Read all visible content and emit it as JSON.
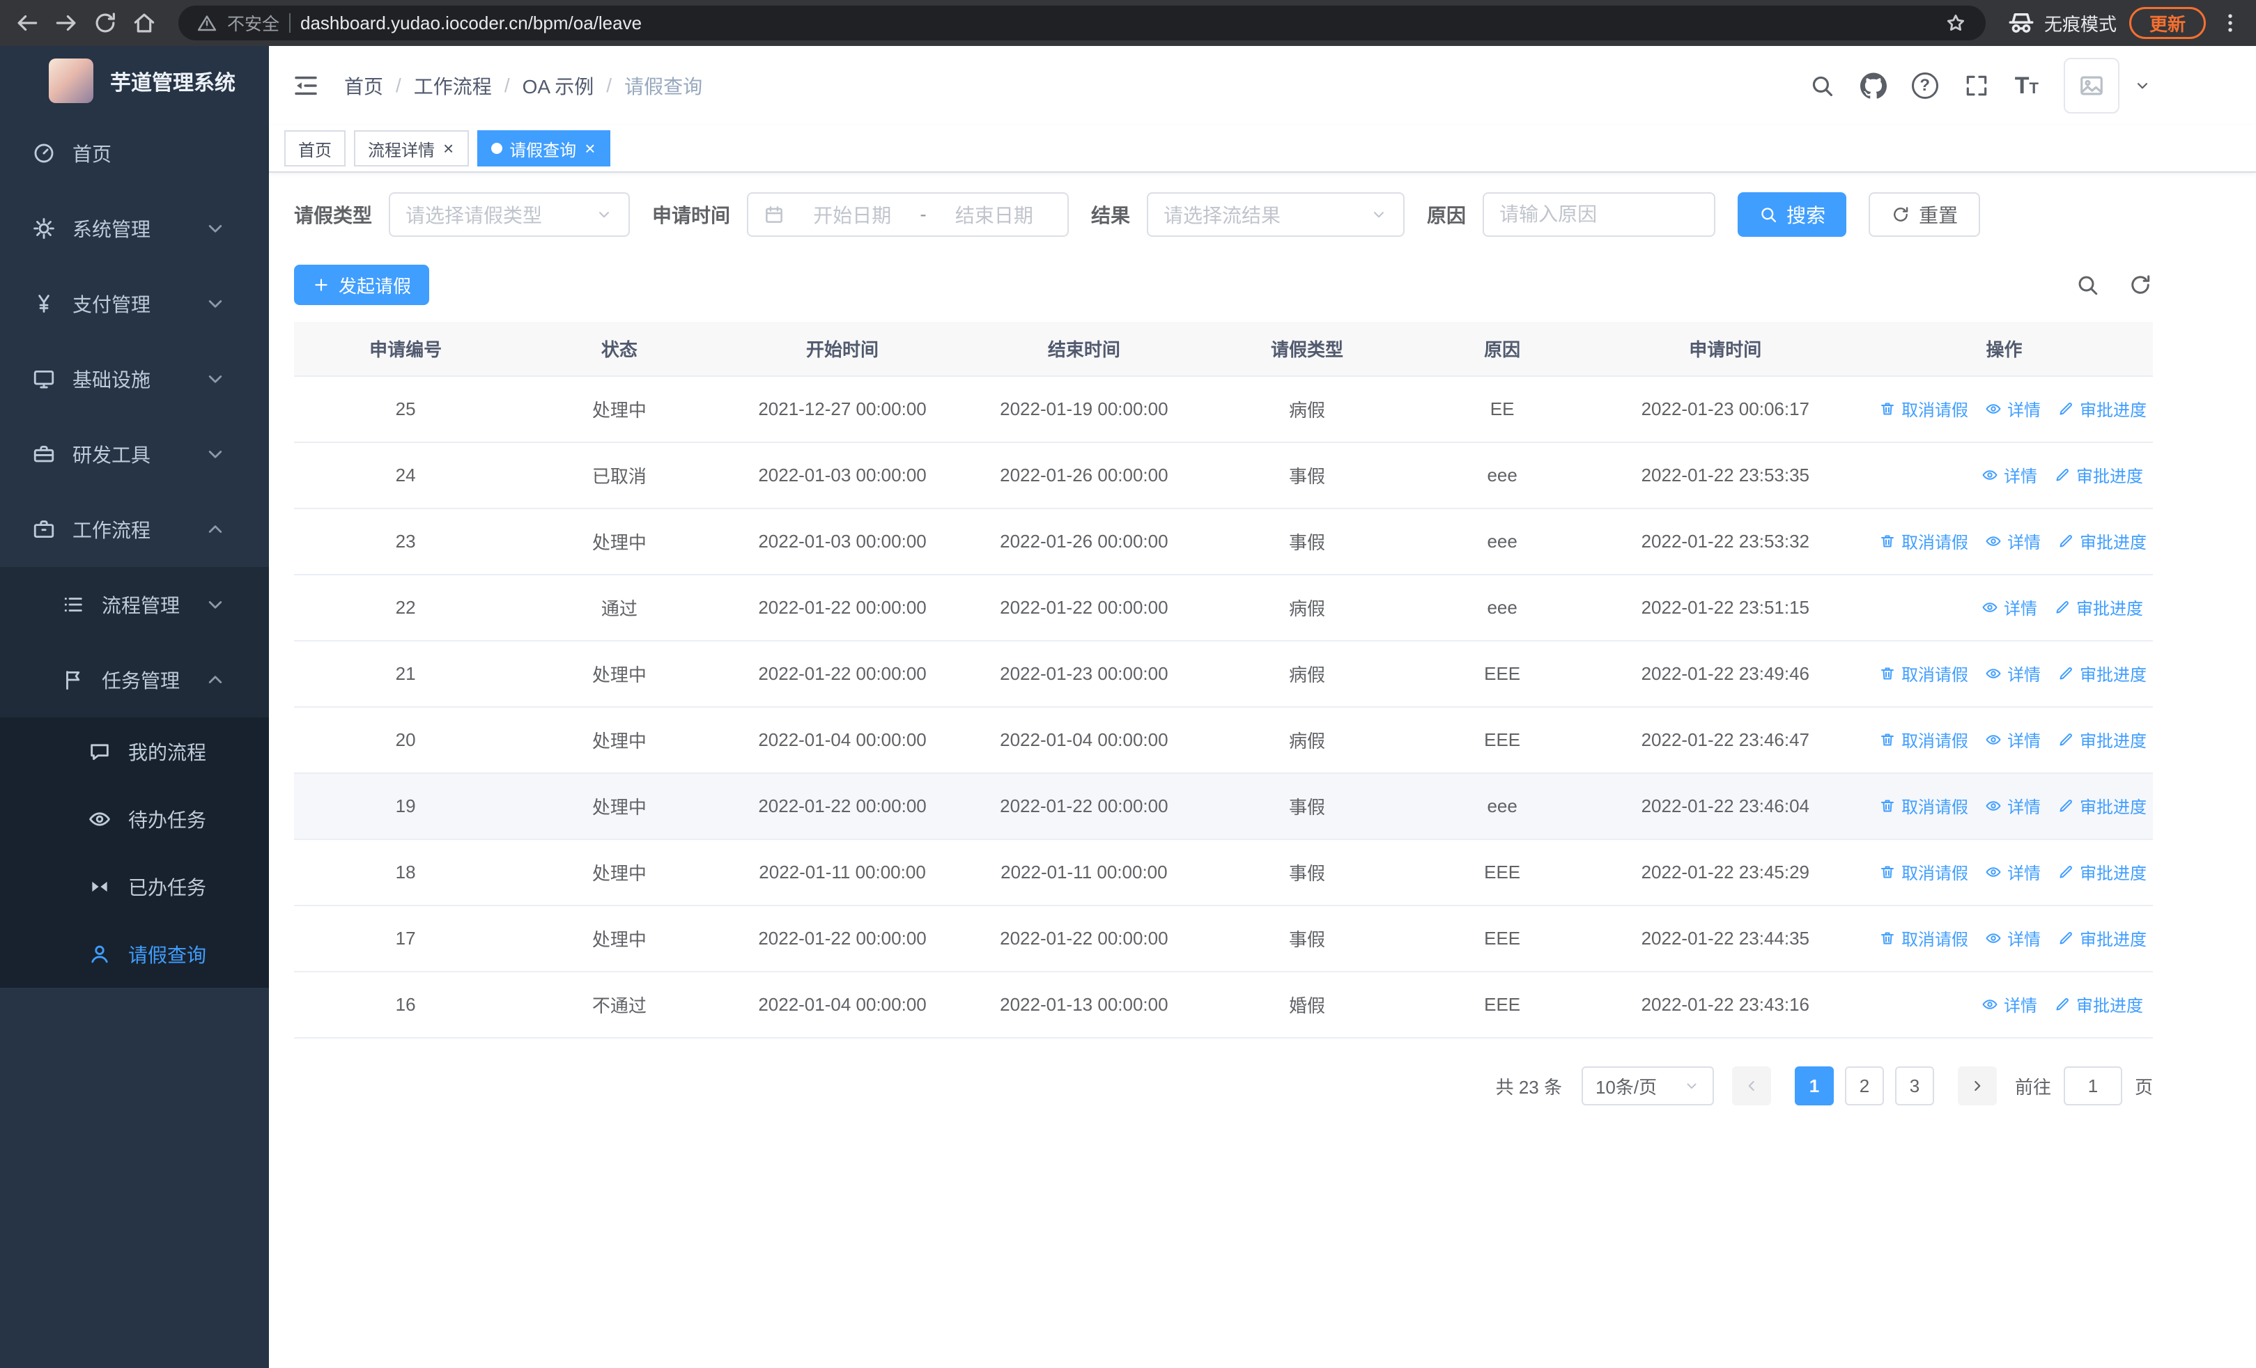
{
  "colors": {
    "primary": "#409eff",
    "sidebar_bg": "#263445",
    "sidebar_sub_bg": "#1f2b39",
    "sidebar_subsub_bg": "#18222e",
    "update_badge": "#f4702f"
  },
  "browser": {
    "security_label": "不安全",
    "url": "dashboard.yudao.iocoder.cn/bpm/oa/leave",
    "incognito_label": "无痕模式",
    "update_label": "更新"
  },
  "app_title": "芋道管理系统",
  "sidebar": {
    "menu": [
      {
        "name": "home",
        "label": "首页",
        "icon": "dashboard-icon",
        "level": 1,
        "arrow": null,
        "active": false
      },
      {
        "name": "system-management",
        "label": "系统管理",
        "icon": "gear-icon",
        "level": 1,
        "arrow": "down",
        "active": false
      },
      {
        "name": "payment-management",
        "label": "支付管理",
        "icon": "yen-icon",
        "level": 1,
        "arrow": "down",
        "active": false
      },
      {
        "name": "infrastructure",
        "label": "基础设施",
        "icon": "monitor-icon",
        "level": 1,
        "arrow": "down",
        "active": false
      },
      {
        "name": "dev-tools",
        "label": "研发工具",
        "icon": "toolbox-icon",
        "level": 1,
        "arrow": "down",
        "active": false
      },
      {
        "name": "workflow",
        "label": "工作流程",
        "icon": "briefcase-icon",
        "level": 1,
        "arrow": "up",
        "active": false
      },
      {
        "name": "process-management",
        "label": "流程管理",
        "icon": "list-icon",
        "level": 2,
        "arrow": "down",
        "active": false
      },
      {
        "name": "task-management",
        "label": "任务管理",
        "icon": "flag-icon",
        "level": 2,
        "arrow": "up",
        "active": false
      },
      {
        "name": "my-processes",
        "label": "我的流程",
        "icon": "chat-icon",
        "level": 3,
        "arrow": null,
        "active": false
      },
      {
        "name": "todo-tasks",
        "label": "待办任务",
        "icon": "eye-icon",
        "level": 3,
        "arrow": null,
        "active": false
      },
      {
        "name": "done-tasks",
        "label": "已办任务",
        "icon": "bowtie-icon",
        "level": 3,
        "arrow": null,
        "active": false
      },
      {
        "name": "leave-query",
        "label": "请假查询",
        "icon": "user-icon",
        "level": 3,
        "arrow": null,
        "active": true
      }
    ]
  },
  "header": {
    "breadcrumb": [
      "首页",
      "工作流程",
      "OA 示例",
      "请假查询"
    ]
  },
  "tabs": [
    {
      "name": "home",
      "label": "首页",
      "closable": false,
      "active": false
    },
    {
      "name": "process-detail",
      "label": "流程详情",
      "closable": true,
      "active": false
    },
    {
      "name": "leave-query",
      "label": "请假查询",
      "closable": true,
      "active": true
    }
  ],
  "filters": {
    "leave_type_label": "请假类型",
    "leave_type_placeholder": "请选择请假类型",
    "apply_time_label": "申请时间",
    "start_date_placeholder": "开始日期",
    "date_separator": "-",
    "end_date_placeholder": "结束日期",
    "result_label": "结果",
    "result_placeholder": "请选择流结果",
    "reason_label": "原因",
    "reason_placeholder": "请输入原因",
    "search_label": "搜索",
    "reset_label": "重置"
  },
  "toolbar": {
    "create_label": "发起请假"
  },
  "table": {
    "columns": [
      "申请编号",
      "状态",
      "开始时间",
      "结束时间",
      "请假类型",
      "原因",
      "申请时间",
      "操作"
    ],
    "action_labels": {
      "cancel": "取消请假",
      "detail": "详情",
      "progress": "审批进度"
    },
    "rows": [
      {
        "id": "25",
        "status": "处理中",
        "start_time": "2021-12-27 00:00:00",
        "end_time": "2022-01-19 00:00:00",
        "leave_type": "病假",
        "reason": "EE",
        "apply_time": "2022-01-23 00:06:17",
        "can_cancel": true,
        "highlighted": false
      },
      {
        "id": "24",
        "status": "已取消",
        "start_time": "2022-01-03 00:00:00",
        "end_time": "2022-01-26 00:00:00",
        "leave_type": "事假",
        "reason": "eee",
        "apply_time": "2022-01-22 23:53:35",
        "can_cancel": false,
        "highlighted": false
      },
      {
        "id": "23",
        "status": "处理中",
        "start_time": "2022-01-03 00:00:00",
        "end_time": "2022-01-26 00:00:00",
        "leave_type": "事假",
        "reason": "eee",
        "apply_time": "2022-01-22 23:53:32",
        "can_cancel": true,
        "highlighted": false
      },
      {
        "id": "22",
        "status": "通过",
        "start_time": "2022-01-22 00:00:00",
        "end_time": "2022-01-22 00:00:00",
        "leave_type": "病假",
        "reason": "eee",
        "apply_time": "2022-01-22 23:51:15",
        "can_cancel": false,
        "highlighted": false
      },
      {
        "id": "21",
        "status": "处理中",
        "start_time": "2022-01-22 00:00:00",
        "end_time": "2022-01-23 00:00:00",
        "leave_type": "病假",
        "reason": "EEE",
        "apply_time": "2022-01-22 23:49:46",
        "can_cancel": true,
        "highlighted": false
      },
      {
        "id": "20",
        "status": "处理中",
        "start_time": "2022-01-04 00:00:00",
        "end_time": "2022-01-04 00:00:00",
        "leave_type": "病假",
        "reason": "EEE",
        "apply_time": "2022-01-22 23:46:47",
        "can_cancel": true,
        "highlighted": false
      },
      {
        "id": "19",
        "status": "处理中",
        "start_time": "2022-01-22 00:00:00",
        "end_time": "2022-01-22 00:00:00",
        "leave_type": "事假",
        "reason": "eee",
        "apply_time": "2022-01-22 23:46:04",
        "can_cancel": true,
        "highlighted": true
      },
      {
        "id": "18",
        "status": "处理中",
        "start_time": "2022-01-11 00:00:00",
        "end_time": "2022-01-11 00:00:00",
        "leave_type": "事假",
        "reason": "EEE",
        "apply_time": "2022-01-22 23:45:29",
        "can_cancel": true,
        "highlighted": false
      },
      {
        "id": "17",
        "status": "处理中",
        "start_time": "2022-01-22 00:00:00",
        "end_time": "2022-01-22 00:00:00",
        "leave_type": "事假",
        "reason": "EEE",
        "apply_time": "2022-01-22 23:44:35",
        "can_cancel": true,
        "highlighted": false
      },
      {
        "id": "16",
        "status": "不通过",
        "start_time": "2022-01-04 00:00:00",
        "end_time": "2022-01-13 00:00:00",
        "leave_type": "婚假",
        "reason": "EEE",
        "apply_time": "2022-01-22 23:43:16",
        "can_cancel": false,
        "highlighted": false
      }
    ]
  },
  "pagination": {
    "total_label": "共 23 条",
    "page_size_label": "10条/页",
    "pages": [
      "1",
      "2",
      "3"
    ],
    "active_page": "1",
    "goto_label": "前往",
    "goto_value": "1",
    "goto_suffix": "页"
  }
}
